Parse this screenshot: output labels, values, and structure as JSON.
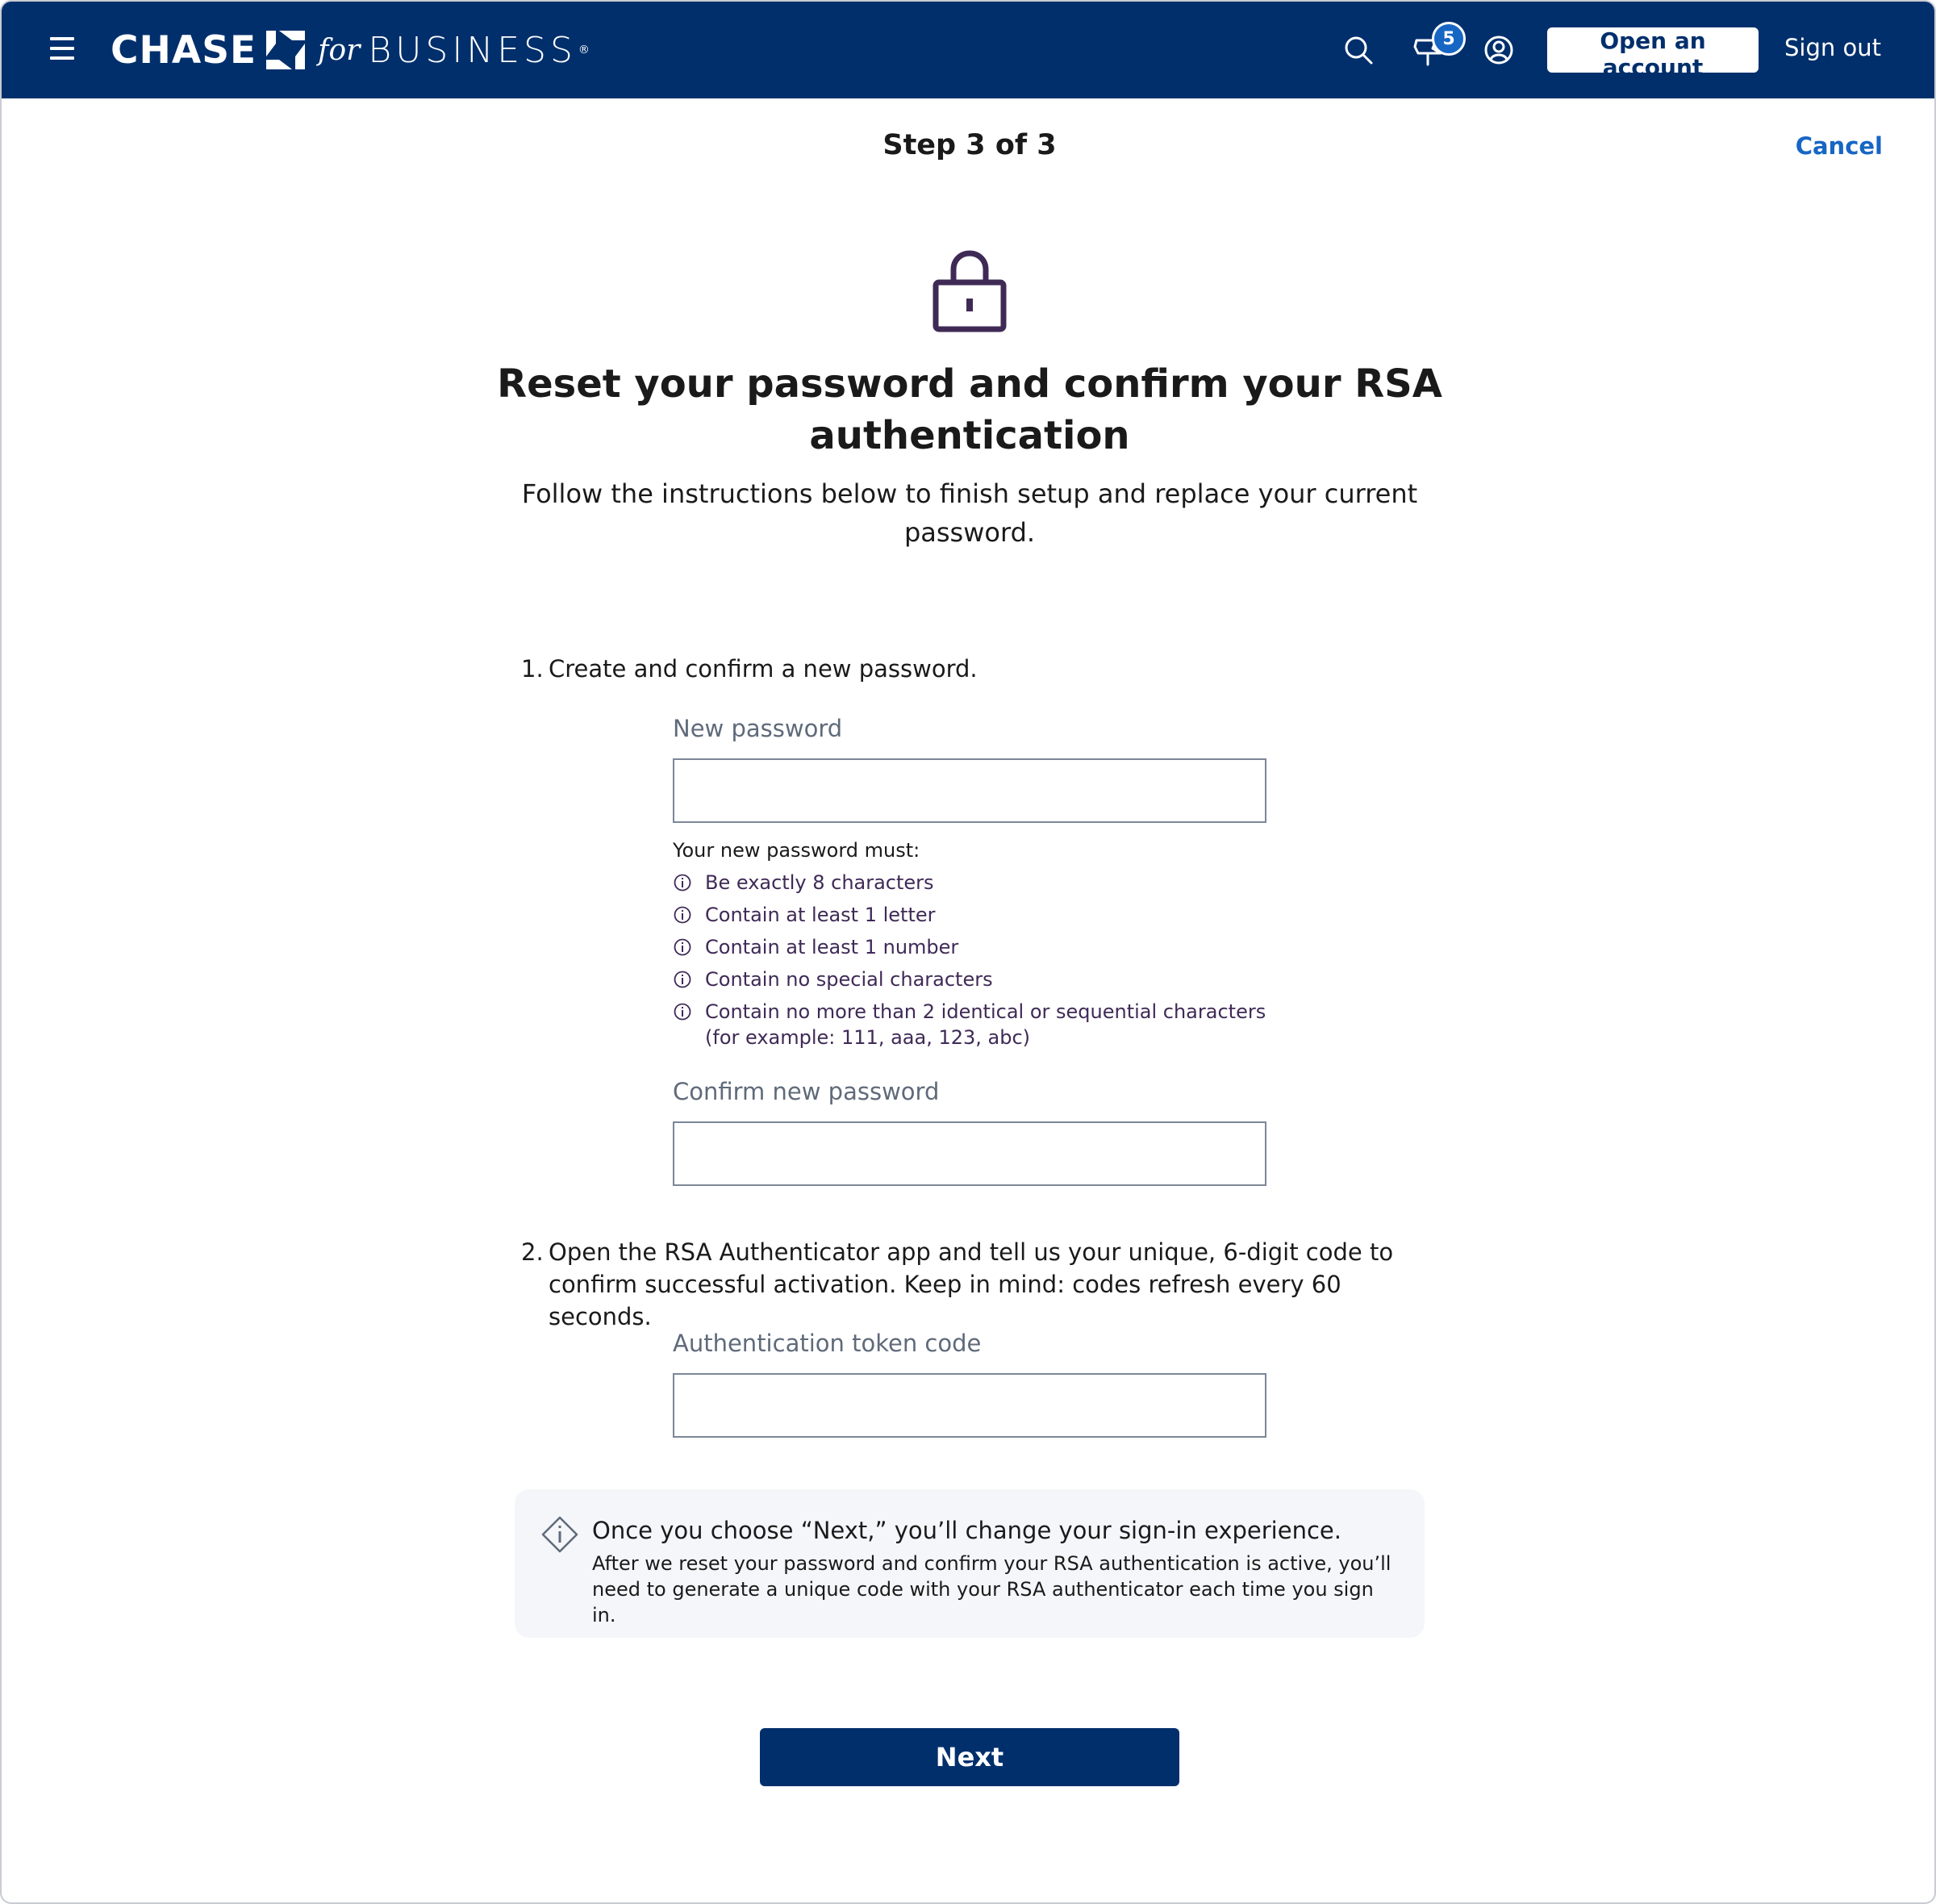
{
  "header": {
    "logo_chase": "CHASE",
    "logo_for": "for",
    "logo_business": "BUSINESS",
    "logo_reg": "®",
    "notification_count": "5",
    "open_account_label": "Open an account",
    "sign_out_label": "Sign out",
    "icons": [
      "menu-icon",
      "search-icon",
      "notification-icon",
      "profile-icon"
    ]
  },
  "step": {
    "title": "Step 3 of 3",
    "cancel_label": "Cancel"
  },
  "hero": {
    "icon": "lock-icon",
    "title": "Reset your password and confirm your RSA authentication",
    "subtitle": "Follow the instructions below to finish setup and replace your current password."
  },
  "form": {
    "step1": {
      "number": "1.",
      "text": "Create and confirm a new password."
    },
    "new_password": {
      "label": "New password",
      "value": ""
    },
    "rules_heading": "Your new password must:",
    "rules": [
      "Be exactly 8 characters",
      "Contain at least 1 letter",
      "Contain at least 1 number",
      "Contain no special characters",
      "Contain no more than 2 identical or sequential characters (for example: 111, aaa, 123, abc)"
    ],
    "confirm_password": {
      "label": "Confirm new password",
      "value": ""
    },
    "step2": {
      "number": "2.",
      "text": "Open the RSA Authenticator app and tell us your unique, 6-digit code to confirm successful activation. Keep in mind: codes refresh every 60 seconds."
    },
    "token": {
      "label": "Authentication token code",
      "value": ""
    }
  },
  "notice": {
    "title": "Once you choose “Next,” you’ll change your sign-in experience.",
    "body": "After we reset your password and confirm your RSA authentication is active, you’ll need to generate a unique code with your RSA authenticator each time you sign in."
  },
  "actions": {
    "next_label": "Next"
  },
  "colors": {
    "header_bg": "#002f6c",
    "link": "#1766c4",
    "lock": "#3f2a56",
    "notice_bg": "#f4f6f9"
  }
}
